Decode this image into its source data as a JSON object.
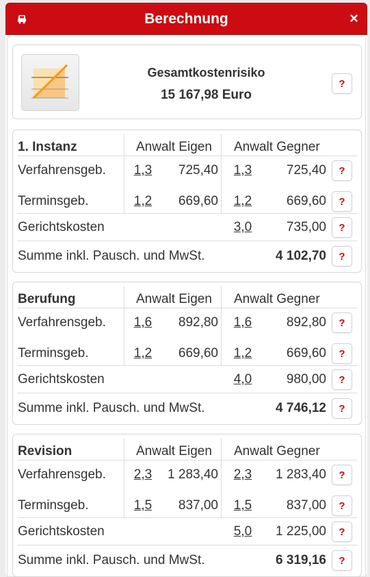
{
  "window": {
    "title": "Berechnung",
    "close_glyph": "×",
    "title_icon": "car-icon",
    "accent_color": "#cc0c12"
  },
  "summary": {
    "title": "Gesamtkostenrisiko",
    "value": "15 167,98 Euro",
    "icon": "chart-icon"
  },
  "help_label": "?",
  "columns": {
    "own": "Anwalt Eigen",
    "opponent": "Anwalt Gegner"
  },
  "sections": [
    {
      "name": "1. Instanz",
      "rows": [
        {
          "label": "Verfahrensgeb.",
          "own_factor": "1,3",
          "own_amount": "725,40",
          "opp_factor": "1,3",
          "opp_amount": "725,40"
        },
        {
          "label": "Terminsgeb.",
          "own_factor": "1,2",
          "own_amount": "669,60",
          "opp_factor": "1,2",
          "opp_amount": "669,60"
        }
      ],
      "court": {
        "label": "Gerichtskosten",
        "factor": "3,0",
        "amount": "735,00"
      },
      "sum": {
        "label": "Summe inkl. Pausch. und MwSt.",
        "amount": "4 102,70"
      }
    },
    {
      "name": "Berufung",
      "rows": [
        {
          "label": "Verfahrensgeb.",
          "own_factor": "1,6",
          "own_amount": "892,80",
          "opp_factor": "1,6",
          "opp_amount": "892,80"
        },
        {
          "label": "Terminsgeb.",
          "own_factor": "1,2",
          "own_amount": "669,60",
          "opp_factor": "1,2",
          "opp_amount": "669,60"
        }
      ],
      "court": {
        "label": "Gerichtskosten",
        "factor": "4,0",
        "amount": "980,00"
      },
      "sum": {
        "label": "Summe inkl. Pausch. und MwSt.",
        "amount": "4 746,12"
      }
    },
    {
      "name": "Revision",
      "rows": [
        {
          "label": "Verfahrensgeb.",
          "own_factor": "2,3",
          "own_amount": "1 283,40",
          "opp_factor": "2,3",
          "opp_amount": "1 283,40"
        },
        {
          "label": "Terminsgeb.",
          "own_factor": "1,5",
          "own_amount": "837,00",
          "opp_factor": "1,5",
          "opp_amount": "837,00"
        }
      ],
      "court": {
        "label": "Gerichtskosten",
        "factor": "5,0",
        "amount": "1 225,00"
      },
      "sum": {
        "label": "Summe inkl. Pausch. und MwSt.",
        "amount": "6 319,16"
      }
    }
  ]
}
